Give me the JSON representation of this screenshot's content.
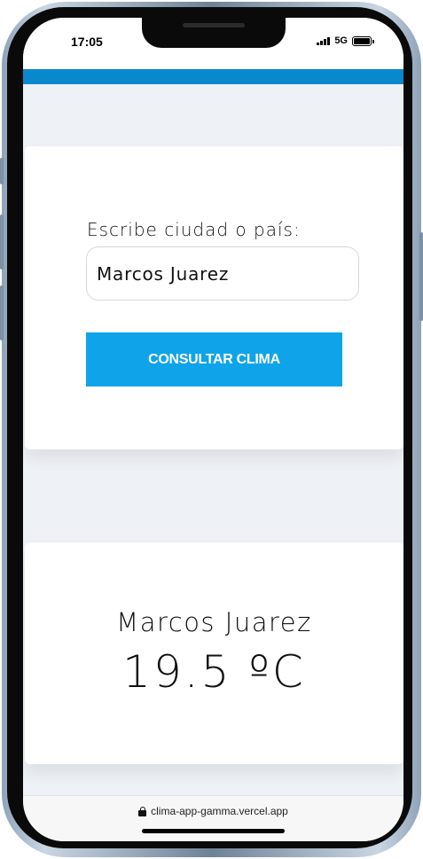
{
  "status_bar": {
    "time": "17:05",
    "network": "5G"
  },
  "colors": {
    "accent_bar": "#0a88cc",
    "button": "#0fa4e9",
    "page_background": "#eef2f7"
  },
  "search_form": {
    "label": "Escribe ciudad o país:",
    "input_value": "Marcos Juarez",
    "submit_label": "CONSULTAR CLIMA"
  },
  "result": {
    "city": "Marcos Juarez",
    "temperature": "19.5 ºC"
  },
  "browser": {
    "url": "clima-app-gamma.vercel.app",
    "lock_icon": "lock-icon"
  }
}
